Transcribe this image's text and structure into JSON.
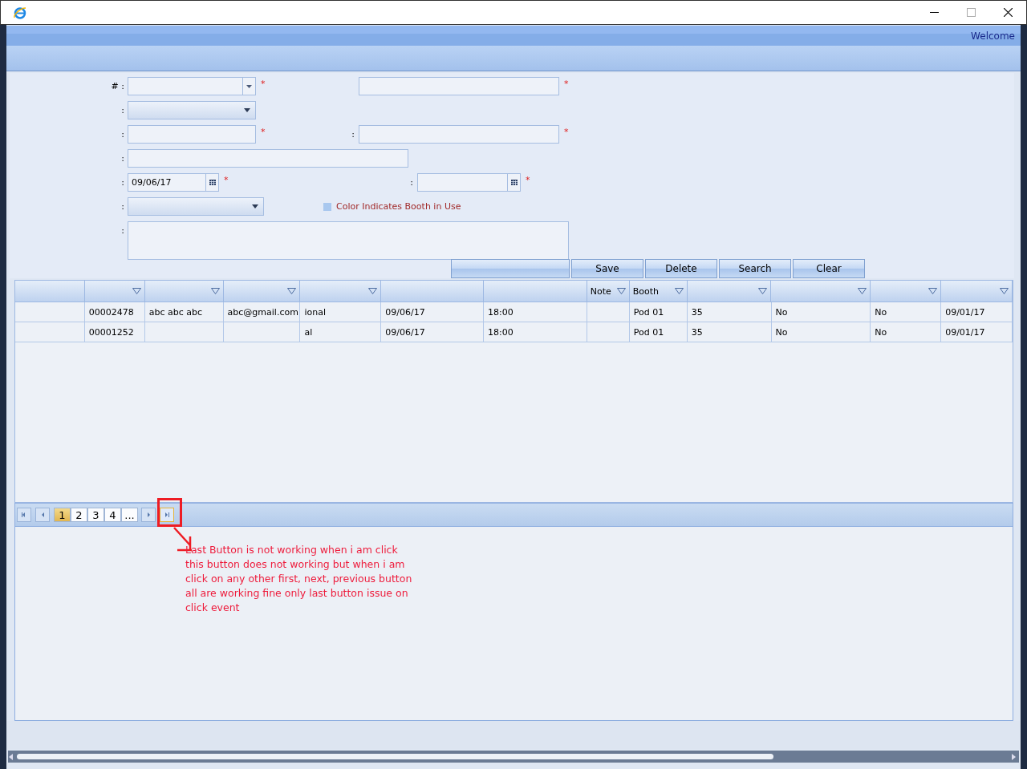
{
  "header": {
    "welcome": "Welcome"
  },
  "form": {
    "rows": [
      {
        "left": {
          "label": "# :",
          "kind": "combo",
          "mark": "*"
        },
        "right": {
          "kind": "text",
          "mark": "*"
        }
      },
      {
        "left": {
          "label": ":",
          "kind": "dropdown"
        }
      },
      {
        "left": {
          "label": ":",
          "kind": "text",
          "mark": "*"
        },
        "right": {
          "label": ":",
          "kind": "text",
          "mark": "*"
        }
      },
      {
        "left": {
          "label": ":",
          "kind": "text"
        }
      },
      {
        "left": {
          "label": ":",
          "kind": "date",
          "value": "09/06/17",
          "mark": "*"
        },
        "right": {
          "label": ":",
          "kind": "date",
          "mark": "*"
        }
      },
      {
        "left": {
          "label": ":",
          "kind": "dropdown"
        },
        "legend": {
          "text": "Color Indicates Booth in Use",
          "color": "#a9c8ef"
        }
      },
      {
        "left": {
          "label": ":",
          "kind": "textarea"
        }
      }
    ]
  },
  "buttons": [
    "Save",
    "Delete",
    "Search",
    "Clear"
  ],
  "grid": {
    "columns": [
      {
        "filter": false
      },
      {
        "filter": true
      },
      {
        "filter": true
      },
      {
        "filter": true
      },
      {
        "filter": true
      },
      {
        "filter": false
      },
      {
        "filter": false
      },
      {
        "label": "Note",
        "filter": true
      },
      {
        "label": "Booth",
        "filter": true
      },
      {
        "filter": true
      },
      {
        "filter": true
      },
      {
        "filter": true
      },
      {
        "filter": true
      }
    ],
    "rows": [
      {
        "cells": [
          null,
          "00002478",
          "abc abc abc",
          "abc@gmail.com",
          "ional",
          "09/06/17",
          "18:00",
          null,
          "Pod 01",
          "35",
          "No",
          "No",
          "09/01/17"
        ]
      },
      {
        "cells": [
          null,
          "00001252",
          null,
          null,
          "al",
          "09/06/17",
          "18:00",
          null,
          "Pod 01",
          "35",
          "No",
          "No",
          "09/01/17"
        ]
      }
    ]
  },
  "pager": {
    "pages": [
      {
        "label": "1",
        "selected": true
      },
      {
        "label": "2",
        "selected": false
      },
      {
        "label": "3",
        "selected": false
      },
      {
        "label": "4",
        "selected": false
      },
      {
        "label": "...",
        "selected": false
      }
    ],
    "last_highlighted": true
  },
  "annotation": {
    "text": "Last Button is not working  when i am click this button does not working but when i am click on any other first, next, previous button all are working fine only last button issue on click event"
  }
}
